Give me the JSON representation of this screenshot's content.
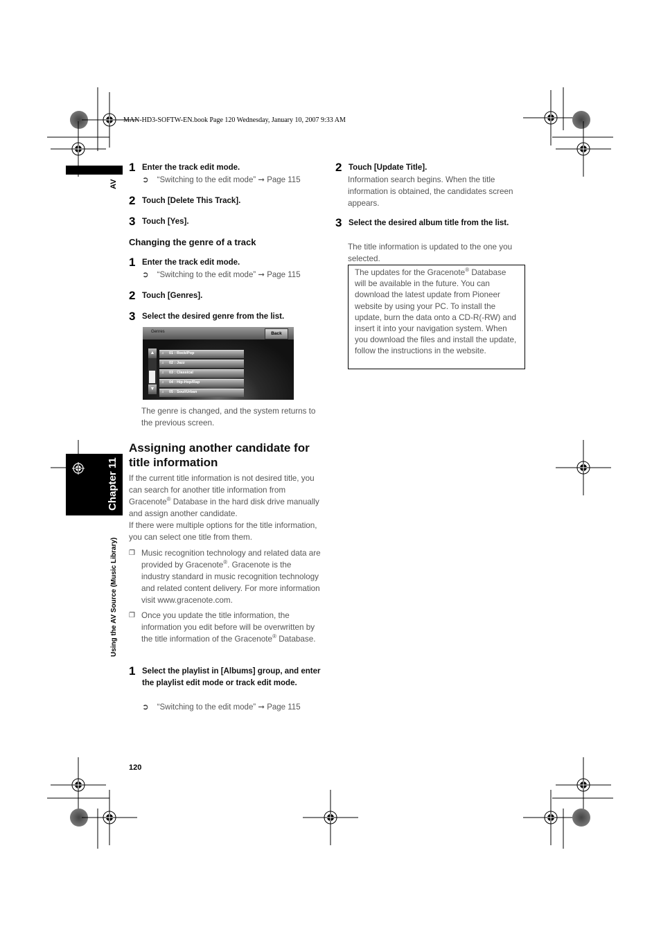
{
  "print_header": "MAN-HD3-SOFTW-EN.book  Page 120  Wednesday, January 10, 2007  9:33 AM",
  "side_tab": {
    "section": "AV",
    "chapter": "Chapter 11",
    "running_title": "Using the AV Source (Music Library)"
  },
  "left_column": {
    "steps_delete": [
      {
        "num": "1",
        "text": "Enter the track edit mode.",
        "ref": "“Switching to the edit mode” ➞ Page 115"
      },
      {
        "num": "2",
        "text": "Touch [Delete This Track]."
      },
      {
        "num": "3",
        "text": "Touch [Yes]."
      }
    ],
    "genre_heading": "Changing the genre of a track",
    "steps_genre": [
      {
        "num": "1",
        "text": "Enter the track edit mode.",
        "ref": "“Switching to the edit mode” ➞ Page 115"
      },
      {
        "num": "2",
        "text": "Touch [Genres]."
      },
      {
        "num": "3",
        "text": "Select the desired genre from the list."
      }
    ],
    "screenshot": {
      "title": "Genres",
      "back_button": "Back",
      "items": [
        {
          "icon": "music-note-icon",
          "label": "01 : Rock/Pop"
        },
        {
          "icon": "music-note-icon",
          "label": "02 : Jazz"
        },
        {
          "icon": "music-note-icon",
          "label": "03 : Classical"
        },
        {
          "icon": "music-note-icon",
          "label": "04 : Hip-Hop/Rap"
        },
        {
          "icon": "music-note-icon",
          "label": "05 : Soul/Urban"
        }
      ],
      "scroll_up": "▲",
      "scroll_down": "▼"
    },
    "genre_result": "The genre is changed, and the system returns to the previous screen.",
    "section_heading_line1": "Assigning another candidate for",
    "section_heading_line2": "title information",
    "intro_p1_a": "If the current title information is not desired title, you can search for another title information from Gracenote",
    "intro_p1_b": " Database in the hard disk drive manually and assign another candidate.",
    "intro_p2": "If there were multiple options for the title information, you can select one title from them.",
    "note1_a": "Music recognition technology and related data are provided by Gracenote",
    "note1_b": ". Gracenote is the industry standard in music recognition technology and related content delivery. For more information visit www.gracenote.com.",
    "note2_a": "Once you update the title information, the information you edit before will be overwritten by the title information of the Gracenote",
    "note2_b": " Database.",
    "step_final": {
      "num": "1",
      "text": "Select the playlist in [Albums] group, and enter the playlist edit mode or track edit mode.",
      "ref": "“Switching to the edit mode” ➞ Page 115"
    },
    "registered": "®",
    "ref_symbol": "➲",
    "checkbox_symbol": "❐"
  },
  "right_column": {
    "step2": {
      "num": "2",
      "text": "Touch [Update Title].",
      "body": "Information search begins. When the title information is obtained, the candidates screen appears."
    },
    "step3": {
      "num": "3",
      "text": "Select the desired album title from the list.",
      "body": "The title information is updated to the one you selected."
    },
    "note_box_a": "The updates for the Gracenote",
    "note_box_b": " Database will be available in the future. You can download the latest update from Pioneer website by using your PC. To install the update, burn the data onto a CD-R(-RW) and insert it into your navigation system. When you download the files and install the update, follow the instructions in the website."
  },
  "page_number": "120"
}
